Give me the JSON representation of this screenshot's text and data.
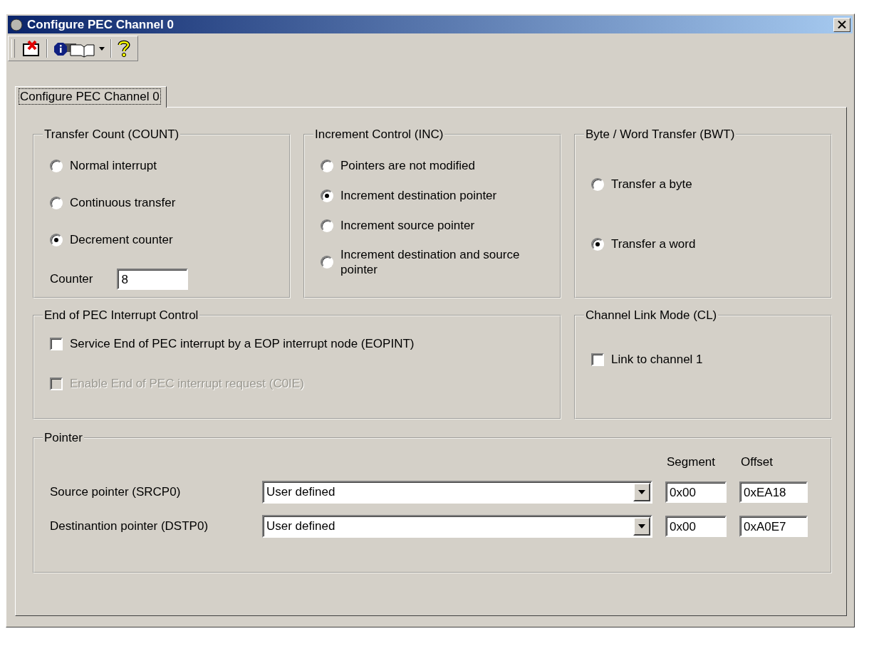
{
  "window": {
    "title": "Configure PEC Channel 0"
  },
  "tabs": [
    {
      "label": "Configure PEC Channel 0",
      "selected": true
    }
  ],
  "transfer_count": {
    "title": "Transfer Count (COUNT)",
    "options": [
      {
        "label": "Normal interrupt",
        "selected": false
      },
      {
        "label": "Continuous transfer",
        "selected": false
      },
      {
        "label": "Decrement counter",
        "selected": true
      }
    ],
    "counter": {
      "label": "Counter",
      "value": "8"
    }
  },
  "increment_control": {
    "title": "Increment Control (INC)",
    "options": [
      {
        "label": "Pointers are not modified",
        "selected": false
      },
      {
        "label": "Increment destination pointer",
        "selected": true
      },
      {
        "label": "Increment source pointer",
        "selected": false
      },
      {
        "label": "Increment destination and source pointer",
        "selected": false
      }
    ]
  },
  "byte_word_transfer": {
    "title": "Byte / Word Transfer (BWT)",
    "options": [
      {
        "label": "Transfer a byte",
        "selected": false
      },
      {
        "label": "Transfer a word",
        "selected": true
      }
    ]
  },
  "end_of_pec_interrupt": {
    "title": "End of PEC Interrupt Control",
    "checks": [
      {
        "label": "Service End of PEC interrupt by a EOP interrupt node (EOPINT)",
        "checked": false,
        "disabled": false
      },
      {
        "label": "Enable End of PEC interrupt request (C0IE)",
        "checked": false,
        "disabled": true
      }
    ]
  },
  "channel_link": {
    "title": "Channel Link Mode (CL)",
    "checks": [
      {
        "label": "Link to channel 1",
        "checked": false,
        "disabled": false
      }
    ]
  },
  "pointer": {
    "title": "Pointer",
    "columns": [
      "Segment",
      "Offset"
    ],
    "rows": [
      {
        "label": "Source pointer (SRCP0)",
        "selection": "User defined",
        "segment": "0x00",
        "offset": "0xEA18"
      },
      {
        "label": "Destinantion pointer (DSTP0)",
        "selection": "User defined",
        "segment": "0x00",
        "offset": "0xA0E7"
      }
    ]
  }
}
